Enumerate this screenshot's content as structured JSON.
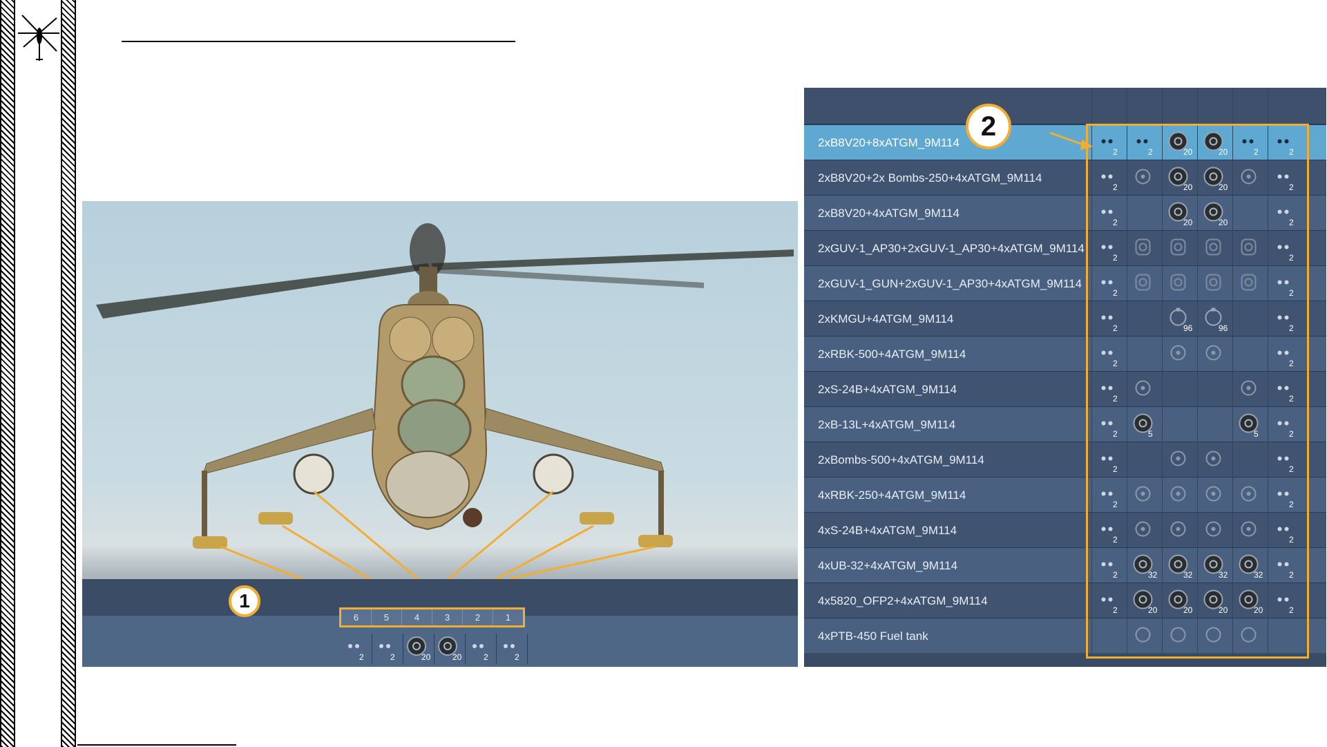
{
  "callouts": {
    "one": "1",
    "two": "2"
  },
  "pylons": [
    "6",
    "5",
    "4",
    "3",
    "2",
    "1"
  ],
  "pylon_stores": [
    {
      "icon": "ptur-pair-icon",
      "count": "2"
    },
    {
      "icon": "ptur-pair-icon",
      "count": "2"
    },
    {
      "icon": "rocket-pod-icon",
      "count": "20"
    },
    {
      "icon": "rocket-pod-icon",
      "count": "20"
    },
    {
      "icon": "ptur-pair-icon",
      "count": "2"
    },
    {
      "icon": "ptur-pair-icon",
      "count": "2"
    }
  ],
  "loadouts": [
    {
      "name": "2xB8V20+8xATGM_9M114",
      "cells": [
        [
          "atgm",
          "2"
        ],
        [
          "atgm",
          "2"
        ],
        [
          "pod",
          "20"
        ],
        [
          "pod",
          "20"
        ],
        [
          "atgm",
          "2"
        ],
        [
          "atgm",
          "2"
        ]
      ]
    },
    {
      "name": "2xB8V20+2x Bombs-250+4xATGM_9M114",
      "cells": [
        [
          "atgm",
          "2"
        ],
        [
          "bomb",
          ""
        ],
        [
          "pod",
          "20"
        ],
        [
          "pod",
          "20"
        ],
        [
          "bomb",
          ""
        ],
        [
          "atgm",
          "2"
        ]
      ]
    },
    {
      "name": "2xB8V20+4xATGM_9M114",
      "cells": [
        [
          "atgm",
          "2"
        ],
        [
          "",
          ""
        ],
        [
          "pod",
          "20"
        ],
        [
          "pod",
          "20"
        ],
        [
          "",
          ""
        ],
        [
          "atgm",
          "2"
        ]
      ]
    },
    {
      "name": "2xGUV-1_AP30+2xGUV-1_AP30+4xATGM_9M114",
      "cells": [
        [
          "atgm",
          "2"
        ],
        [
          "gun",
          ""
        ],
        [
          "gun",
          ""
        ],
        [
          "gun",
          ""
        ],
        [
          "gun",
          ""
        ],
        [
          "atgm",
          "2"
        ]
      ]
    },
    {
      "name": "2xGUV-1_GUN+2xGUV-1_AP30+4xATGM_9M114",
      "cells": [
        [
          "atgm",
          "2"
        ],
        [
          "gun",
          ""
        ],
        [
          "gun",
          ""
        ],
        [
          "gun",
          ""
        ],
        [
          "gun",
          ""
        ],
        [
          "atgm",
          "2"
        ]
      ]
    },
    {
      "name": "2xKMGU+4ATGM_9M114",
      "cells": [
        [
          "atgm",
          "2"
        ],
        [
          "",
          ""
        ],
        [
          "kmgu",
          "96"
        ],
        [
          "kmgu",
          "96"
        ],
        [
          "",
          ""
        ],
        [
          "atgm",
          "2"
        ]
      ]
    },
    {
      "name": "2xRBK-500+4ATGM_9M114",
      "cells": [
        [
          "atgm",
          "2"
        ],
        [
          "",
          ""
        ],
        [
          "bomb",
          ""
        ],
        [
          "bomb",
          ""
        ],
        [
          "",
          ""
        ],
        [
          "atgm",
          "2"
        ]
      ]
    },
    {
      "name": "2xS-24B+4xATGM_9M114",
      "cells": [
        [
          "atgm",
          "2"
        ],
        [
          "bomb",
          ""
        ],
        [
          "",
          ""
        ],
        [
          "",
          ""
        ],
        [
          "bomb",
          ""
        ],
        [
          "atgm",
          "2"
        ]
      ]
    },
    {
      "name": "2xB-13L+4xATGM_9M114",
      "cells": [
        [
          "atgm",
          "2"
        ],
        [
          "pod",
          "5"
        ],
        [
          "",
          ""
        ],
        [
          "",
          ""
        ],
        [
          "pod",
          "5"
        ],
        [
          "atgm",
          "2"
        ]
      ]
    },
    {
      "name": "2xBombs-500+4xATGM_9M114",
      "cells": [
        [
          "atgm",
          "2"
        ],
        [
          "",
          ""
        ],
        [
          "bomb",
          ""
        ],
        [
          "bomb",
          ""
        ],
        [
          "",
          ""
        ],
        [
          "atgm",
          "2"
        ]
      ]
    },
    {
      "name": "4xRBK-250+4ATGM_9M114",
      "cells": [
        [
          "atgm",
          "2"
        ],
        [
          "bomb",
          ""
        ],
        [
          "bomb",
          ""
        ],
        [
          "bomb",
          ""
        ],
        [
          "bomb",
          ""
        ],
        [
          "atgm",
          "2"
        ]
      ]
    },
    {
      "name": "4xS-24B+4xATGM_9M114",
      "cells": [
        [
          "atgm",
          "2"
        ],
        [
          "bomb",
          ""
        ],
        [
          "bomb",
          ""
        ],
        [
          "bomb",
          ""
        ],
        [
          "bomb",
          ""
        ],
        [
          "atgm",
          "2"
        ]
      ]
    },
    {
      "name": "4xUB-32+4xATGM_9M114",
      "cells": [
        [
          "atgm",
          "2"
        ],
        [
          "pod",
          "32"
        ],
        [
          "pod",
          "32"
        ],
        [
          "pod",
          "32"
        ],
        [
          "pod",
          "32"
        ],
        [
          "atgm",
          "2"
        ]
      ]
    },
    {
      "name": "4x5820_OFP2+4xATGM_9M114",
      "cells": [
        [
          "atgm",
          "2"
        ],
        [
          "pod",
          "20"
        ],
        [
          "pod",
          "20"
        ],
        [
          "pod",
          "20"
        ],
        [
          "pod",
          "20"
        ],
        [
          "atgm",
          "2"
        ]
      ]
    },
    {
      "name": "4xPTB-450 Fuel tank",
      "cells": [
        [
          "",
          ""
        ],
        [
          "tank",
          ""
        ],
        [
          "tank",
          ""
        ],
        [
          "tank",
          ""
        ],
        [
          "tank",
          ""
        ],
        [
          "",
          ""
        ]
      ]
    }
  ],
  "colors": {
    "accent": "#f2ad33",
    "selected_row": "#5ea8d2",
    "panel": "#3a4b66"
  }
}
